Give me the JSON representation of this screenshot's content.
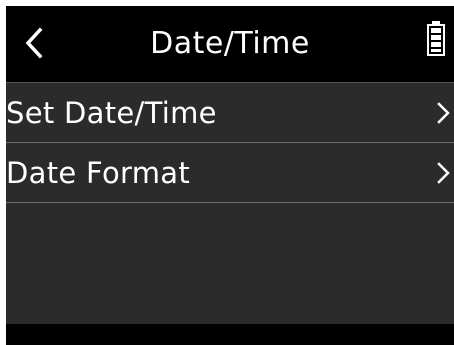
{
  "header": {
    "title": "Date/Time",
    "back_icon": "chevron-left-icon",
    "battery_icon": "battery-icon",
    "battery_level": 1.0
  },
  "menu": {
    "items": [
      {
        "label": "Set Date/Time",
        "icon": "chevron-right-icon"
      },
      {
        "label": "Date Format",
        "icon": "chevron-right-icon"
      }
    ]
  },
  "colors": {
    "background": "#2b2b2b",
    "header": "#000000",
    "text": "#ffffff",
    "divider": "#6a6a6a"
  }
}
